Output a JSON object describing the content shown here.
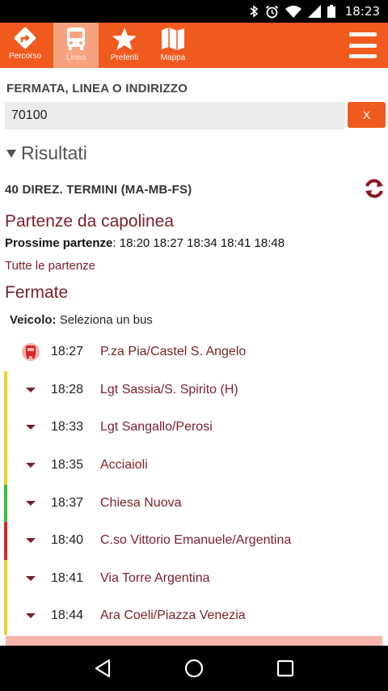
{
  "status_bar": {
    "time": "18:23"
  },
  "nav": {
    "tabs": [
      {
        "label": "Percorso",
        "icon": "directions-icon"
      },
      {
        "label": "Linea",
        "icon": "bus-icon"
      },
      {
        "label": "Preferiti",
        "icon": "star-icon"
      },
      {
        "label": "Mappa",
        "icon": "map-icon"
      }
    ],
    "active_tab": "Linea",
    "accent_color": "#f05a1e"
  },
  "search": {
    "label": "FERMATA, LINEA O INDIRIZZO",
    "value": "70100",
    "clear_label": "X"
  },
  "results": {
    "header": "Risultati",
    "line_title": "40 DIREZ. TERMINI (MA-MB-FS)",
    "departures_heading": "Partenze da capolinea",
    "next_departures_label": "Prossime partenze",
    "next_departures_times": ": 18:20 18:27 18:34 18:41 18:48",
    "all_departures_link": "Tutte le partenze",
    "stops_heading": "Fermate",
    "vehicle_label": "Veicolo:",
    "vehicle_value": " Seleziona un bus",
    "stops": [
      {
        "time": "18:27",
        "name": "P.za Pia/Castel S. Angelo",
        "marker": "bus",
        "bar_color": ""
      },
      {
        "time": "18:28",
        "name": "Lgt Sassia/S. Spirito (H)",
        "marker": "arrow",
        "bar_color": "#f2d12e"
      },
      {
        "time": "18:33",
        "name": "Lgt Sangallo/Perosi",
        "marker": "arrow",
        "bar_color": "#f2d12e"
      },
      {
        "time": "18:35",
        "name": "Acciaioli",
        "marker": "arrow",
        "bar_color": "#f2d12e"
      },
      {
        "time": "18:37",
        "name": "Chiesa Nuova",
        "marker": "arrow",
        "bar_color": "#3cc23c"
      },
      {
        "time": "18:40",
        "name": "C.so Vittorio Emanuele/Argentina",
        "marker": "arrow",
        "bar_color": "#d9252a"
      },
      {
        "time": "18:41",
        "name": "Via Torre Argentina",
        "marker": "arrow",
        "bar_color": "#f2d12e"
      },
      {
        "time": "18:44",
        "name": "Ara Coeli/Piazza Venezia",
        "marker": "arrow",
        "bar_color": "#f2d12e"
      }
    ]
  }
}
